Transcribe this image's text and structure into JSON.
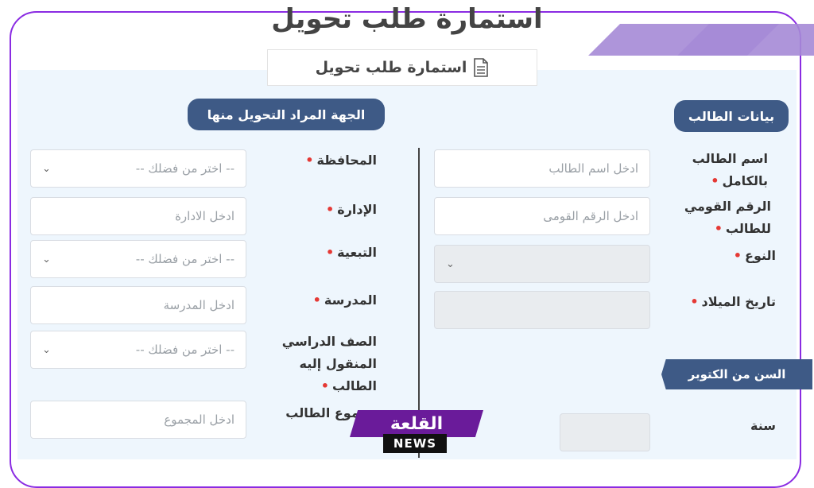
{
  "title": "استمارة طلب تحويل",
  "form_tab": {
    "label": "استمارة طلب تحويل",
    "icon": "document-icon"
  },
  "student_section": {
    "header": "بيانات الطالب",
    "fields": {
      "full_name": {
        "label_line1": "اسم الطالب",
        "label_line2": "بالكامل",
        "placeholder": "ادخل اسم الطالب"
      },
      "national_id": {
        "label_line1": "الرقم القومي",
        "label_line2": "للطالب",
        "placeholder": "ادخل الرقم القومى"
      },
      "gender": {
        "label": "النوع"
      },
      "birth_date": {
        "label": "تاريخ الميلاد"
      }
    },
    "age_ribbon": "السن من الكتوبر",
    "year_label": "سنة"
  },
  "origin_section": {
    "header": "الجهة المراد التحويل منها",
    "fields": {
      "governorate": {
        "label": "المحافظة",
        "value": "-- اختر من فضلك --"
      },
      "administration": {
        "label": "الإدارة",
        "placeholder": "ادخل الادارة"
      },
      "affiliation": {
        "label": "التبعية",
        "value": "-- اختر من فضلك --"
      },
      "school": {
        "label": "المدرسة",
        "placeholder": "ادخل المدرسة"
      },
      "grade": {
        "label_line1": "الصف الدراسي",
        "label_line2": "المنقول إليه",
        "label_line3": "الطالب",
        "value": "-- اختر من فضلك --"
      },
      "total": {
        "label": "مجموع الطالب",
        "placeholder": "ادخل المجموع"
      }
    }
  },
  "required_mark": "•",
  "watermark": {
    "top": "القلعة",
    "bottom": "NEWS"
  },
  "colors": {
    "accent": "#3e5a86",
    "frame": "#8a2be2",
    "panel": "#eef6fd",
    "required": "#e53935"
  }
}
